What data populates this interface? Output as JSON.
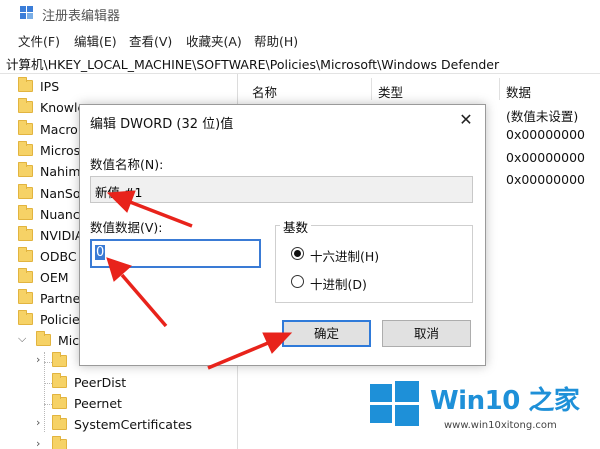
{
  "window": {
    "title": "注册表编辑器"
  },
  "menu": [
    "文件(F)",
    "编辑(E)",
    "查看(V)",
    "收藏夹(A)",
    "帮助(H)"
  ],
  "address": "计算机\\HKEY_LOCAL_MACHINE\\SOFTWARE\\Policies\\Microsoft\\Windows Defender",
  "tree": {
    "items": [
      "IPS",
      "Knowle",
      "Macro",
      "Micros",
      "Nahim",
      "NanSo",
      "Nuanc",
      "NVIDIA",
      "ODBC",
      "OEM",
      "Partne",
      "Policies",
      "Mic"
    ],
    "sub_items": [
      "PeerDist",
      "Peernet",
      "SystemCertificates"
    ]
  },
  "list": {
    "columns": [
      "名称",
      "类型",
      "数据"
    ],
    "data_values": [
      "(数值未设置)",
      "0x00000000",
      "0x00000000",
      "0x00000000"
    ]
  },
  "dialog": {
    "title": "编辑 DWORD (32 位)值",
    "close_glyph": "✕",
    "value_name_label": "数值名称(N):",
    "value_name": "新值 #1",
    "value_data_label": "数值数据(V):",
    "value_data": "0",
    "base_label": "基数",
    "radio_hex": "十六进制(H)",
    "radio_dec": "十进制(D)",
    "ok_label": "确定",
    "cancel_label": "取消"
  },
  "watermark": {
    "title": "Win10 之家",
    "url": "www.win10xitong.com"
  },
  "colors": {
    "accent": "#3a7bd5",
    "arrow": "#e8231b",
    "watermark_blue": "#1e90d8",
    "folder": "#f6d266"
  }
}
